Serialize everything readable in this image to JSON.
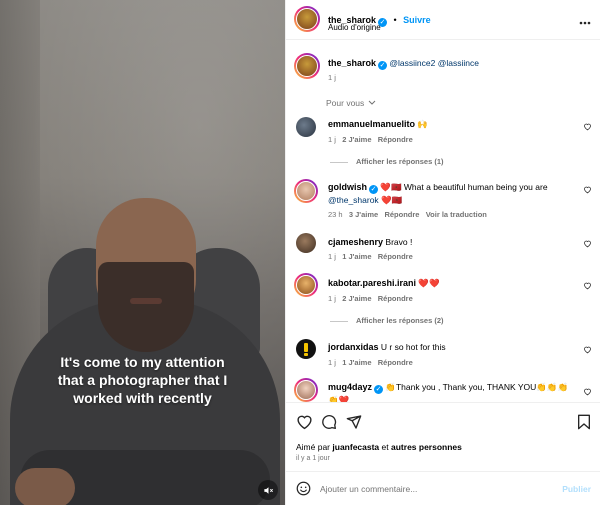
{
  "post": {
    "author": "the_sharok",
    "follow_label": "Suivre",
    "audio": "Audio d'origine",
    "more_icon": "more-horizontal-icon"
  },
  "video": {
    "caption": [
      "It's come to my attention",
      "that a photographer that I",
      "worked with recently"
    ],
    "mute_icon": "speaker-muted-icon"
  },
  "caption_comment": {
    "author": "the_sharok",
    "text": "@lassiince2 @lassiince",
    "time": "1 j"
  },
  "sort_label": "Pour vous",
  "comments": [
    {
      "user": "emmanuelmanuelito",
      "text": "🙌",
      "time": "1 j",
      "likes": "2 J'aime",
      "reply": "Répondre",
      "view_replies": "Afficher les réponses (1)",
      "verified": false
    },
    {
      "user": "goldwish",
      "text": "❤️🇲🇦 What a beautiful human being you are",
      "text2": "@the_sharok",
      "text2_suffix": "❤️🇲🇦",
      "time": "23 h",
      "likes": "3 J'aime",
      "reply": "Répondre",
      "translate": "Voir la traduction",
      "verified": true
    },
    {
      "user": "cjameshenry",
      "text": "Bravo !",
      "time": "1 j",
      "likes": "1 J'aime",
      "reply": "Répondre",
      "verified": false
    },
    {
      "user": "kabotar.pareshi.irani",
      "text": "❤️❤️",
      "time": "1 j",
      "likes": "2 J'aime",
      "reply": "Répondre",
      "view_replies": "Afficher les réponses (2)",
      "verified": false
    },
    {
      "user": "jordanxidas",
      "text": "U r so hot for this",
      "time": "1 j",
      "likes": "1 J'aime",
      "reply": "Répondre",
      "verified": false
    },
    {
      "user": "mug4dayz",
      "text": "👏Thank you , Thank you, THANK YOU👏👏👏",
      "text2": "👏❤️",
      "verified": true
    }
  ],
  "actions": {
    "like_icon": "heart-icon",
    "comment_icon": "comment-icon",
    "share_icon": "share-icon",
    "save_icon": "bookmark-icon"
  },
  "likes_line": {
    "prefix": "Aimé par",
    "user": "juanfecasta",
    "conj": "et",
    "others": "autres personnes"
  },
  "post_time": "il y a 1 jour",
  "add_comment": {
    "placeholder": "Ajouter un commentaire...",
    "publish": "Publier",
    "emoji_icon": "emoji-icon"
  },
  "colors": {
    "accent": "#0095f6",
    "muted": "#737373",
    "link": "#00376b"
  }
}
